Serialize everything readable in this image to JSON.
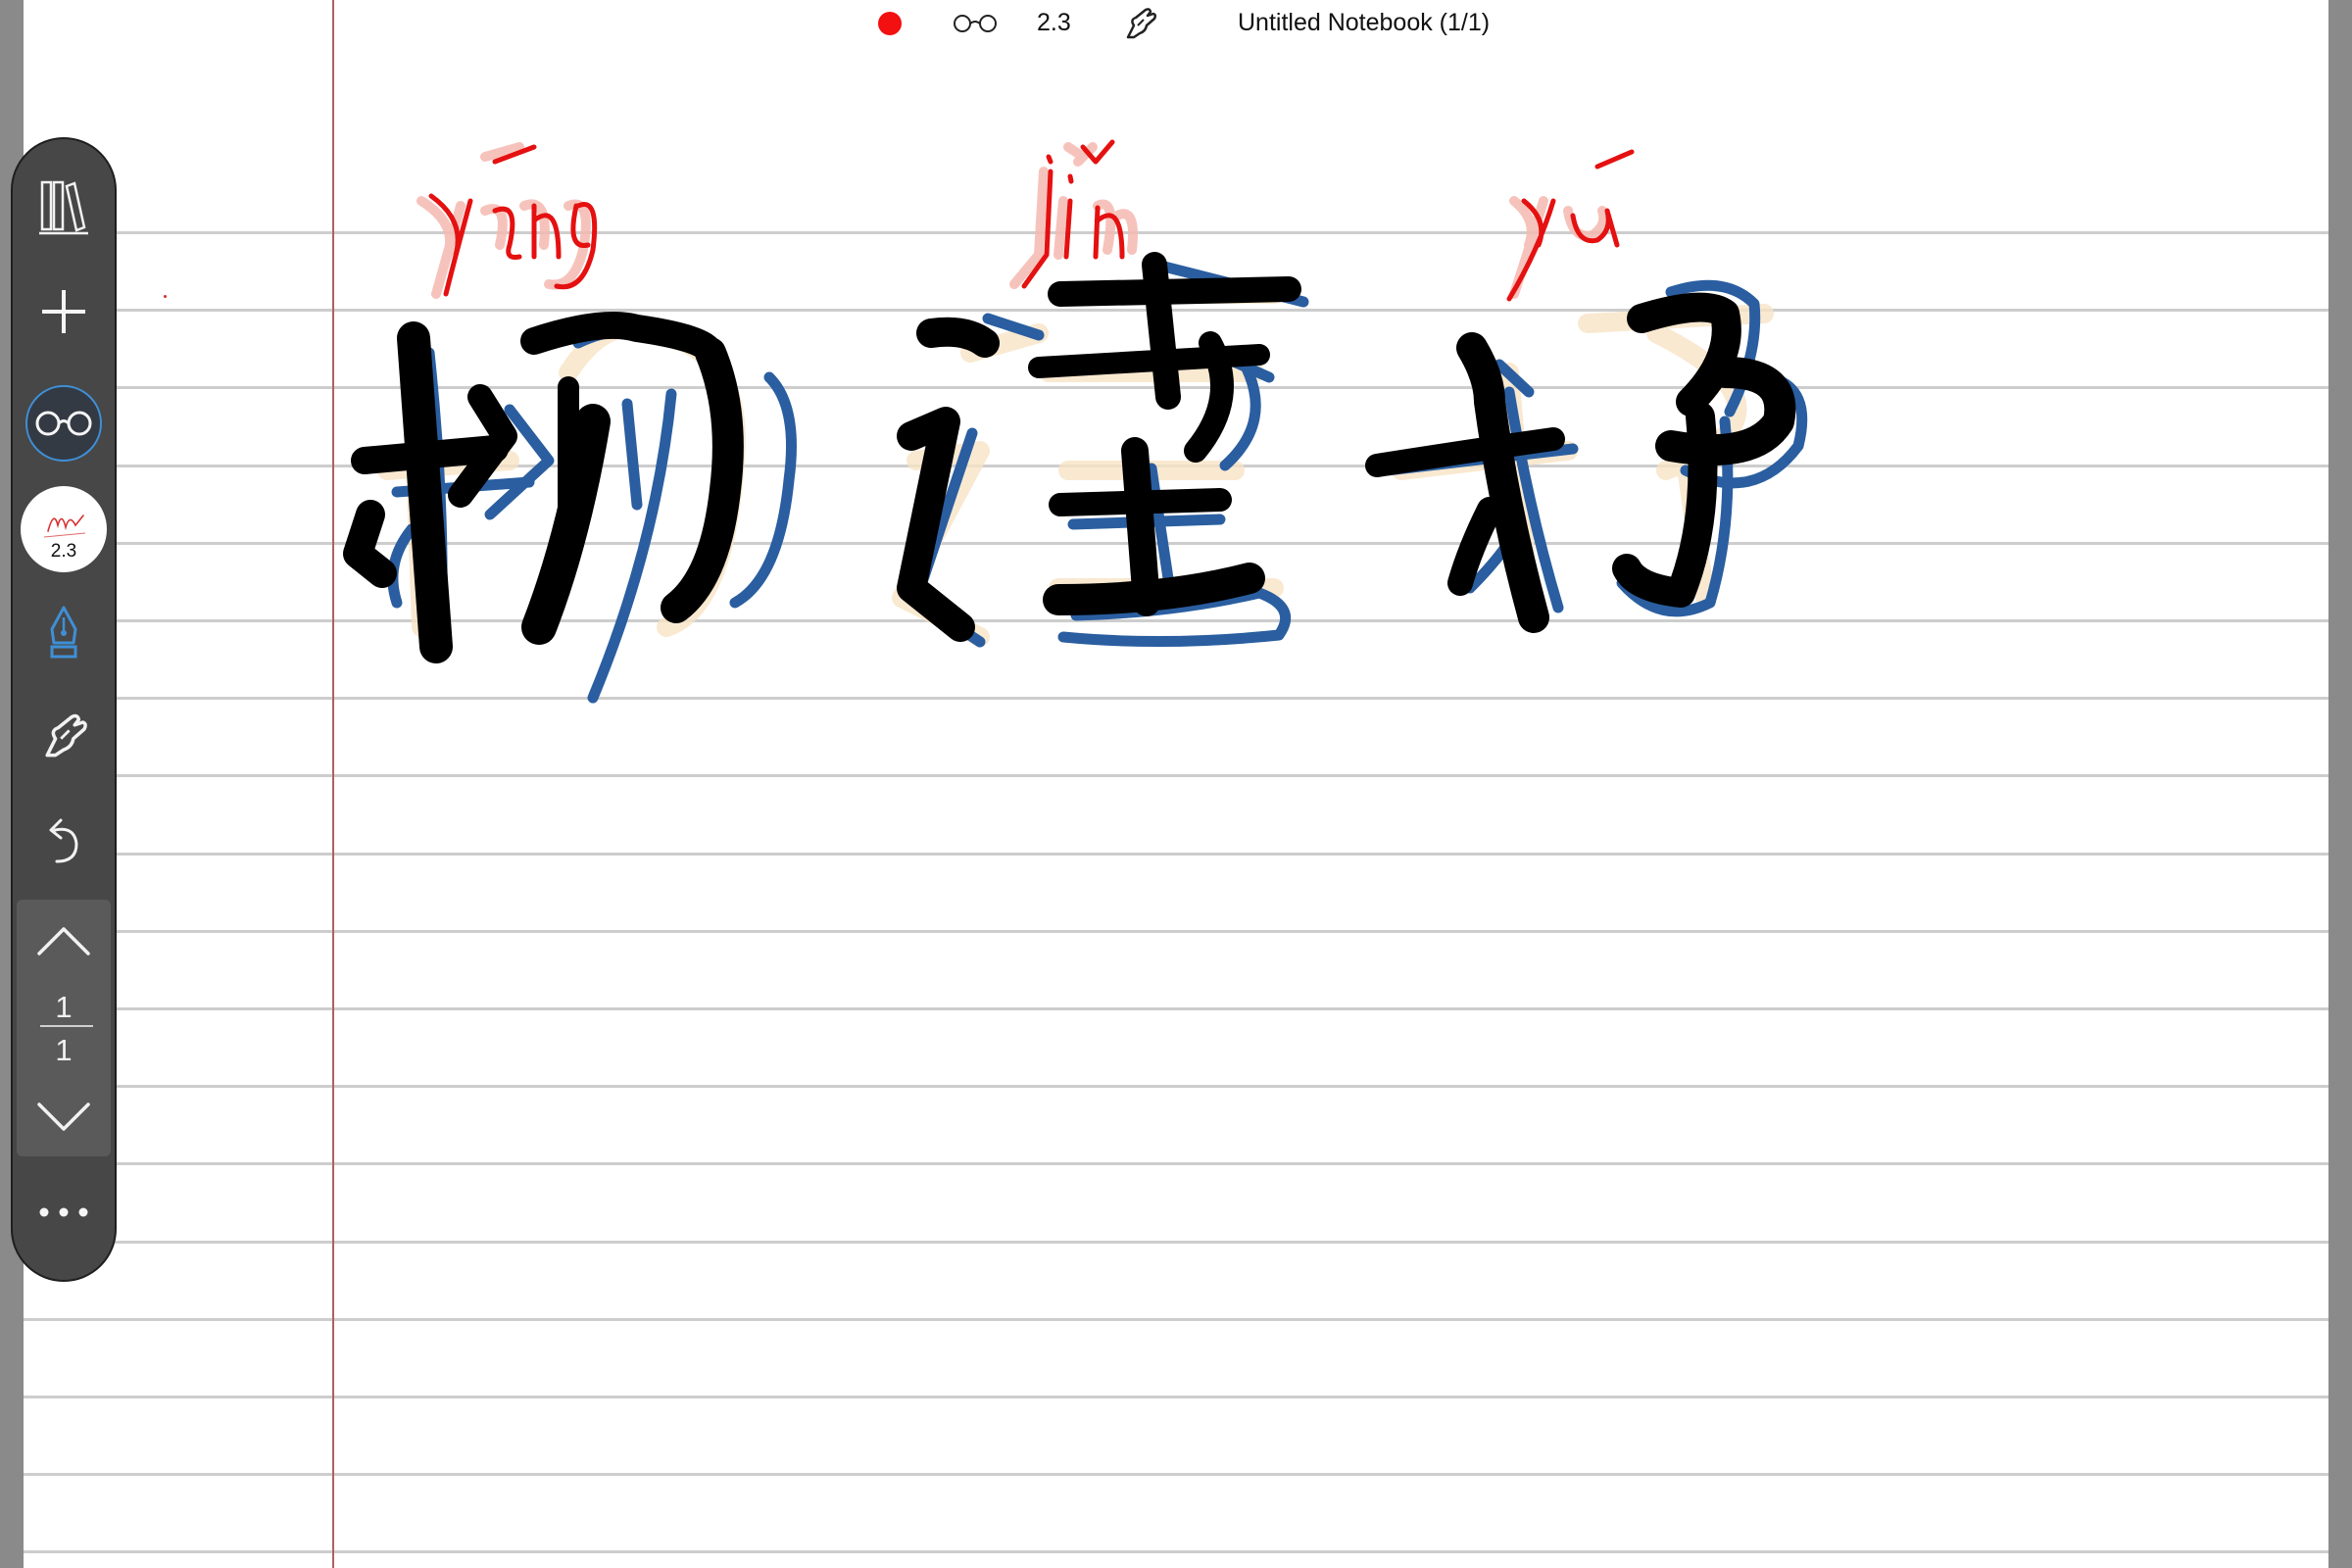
{
  "status_bar": {
    "record_color": "#f21010",
    "view_icon": "glasses-icon",
    "pen_size": "2.3",
    "gesture_icon": "hand-pointer-icon",
    "notebook_title": "Untitled Notebook (1/1)"
  },
  "toolbar": {
    "library_icon": "books-icon",
    "add_icon": "plus-icon",
    "view_mode_icon": "glasses-icon",
    "pen_preset_size": "2.3",
    "pen_tool_icon": "fountain-pen-icon",
    "hand_tool_icon": "hand-pointer-icon",
    "undo_icon": "undo-icon",
    "page_up_icon": "chevron-up-icon",
    "page_current": "1",
    "page_total": "1",
    "page_down_icon": "chevron-down-icon",
    "more_icon": "ellipsis-icon",
    "accent_color": "#3f8fd6"
  },
  "notebook": {
    "ink_colors": {
      "character": "#000000",
      "shadow": "#2a5ea0",
      "pinyin": "#e51010",
      "glow": "#f7e3c6"
    }
  }
}
